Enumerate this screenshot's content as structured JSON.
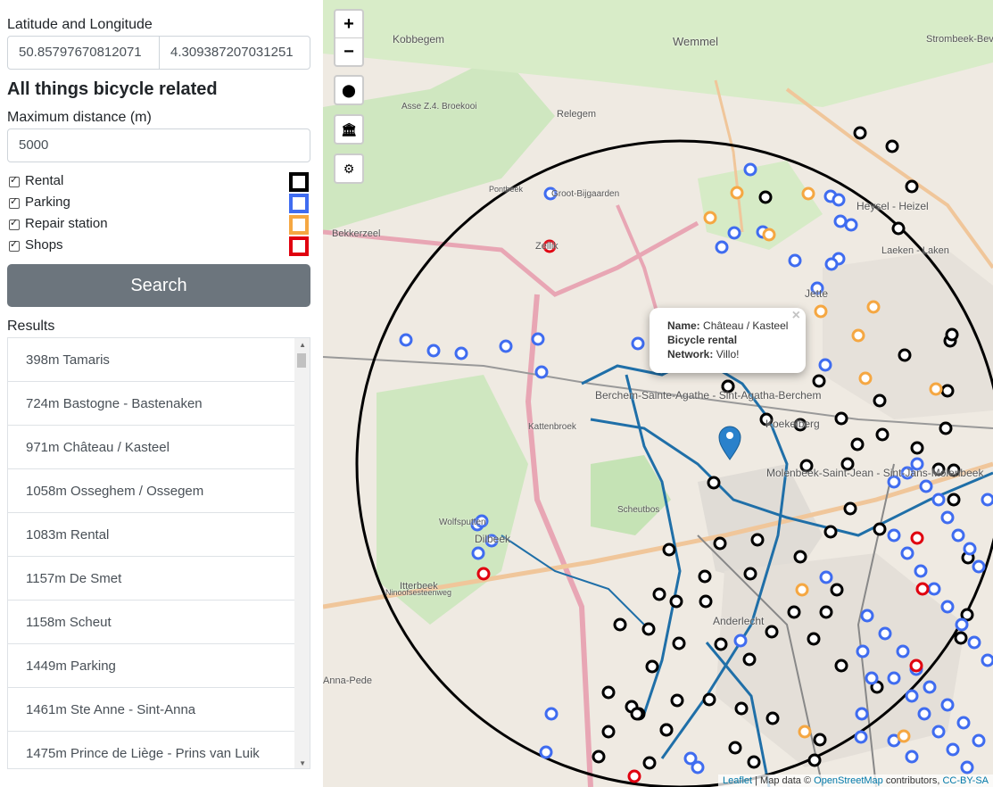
{
  "sidebar": {
    "latlng_label": "Latitude and Longitude",
    "lat": "50.85797670812071",
    "lng": "4.309387207031251",
    "heading": "All things bicycle related",
    "distance_label": "Maximum distance (m)",
    "distance": "5000",
    "categories": [
      {
        "label": "Rental",
        "color": "#000000",
        "checked": true
      },
      {
        "label": "Parking",
        "color": "#3f6cf0",
        "checked": true
      },
      {
        "label": "Repair station",
        "color": "#f5a742",
        "checked": true
      },
      {
        "label": "Shops",
        "color": "#e0000f",
        "checked": true
      }
    ],
    "search_label": "Search",
    "results_label": "Results",
    "results": [
      "398m Tamaris",
      "724m Bastogne - Bastenaken",
      "971m Château / Kasteel",
      "1058m Osseghem / Ossegem",
      "1083m Rental",
      "1157m De Smet",
      "1158m Scheut",
      "1449m Parking",
      "1461m Ste Anne - Sint-Anna",
      "1475m Prince de Liège - Prins van Luik"
    ]
  },
  "map": {
    "zoom_in": "+",
    "zoom_out": "−",
    "popup": {
      "name_key": "Name:",
      "name_val": "Château / Kasteel",
      "type": "Bicycle rental",
      "network_key": "Network:",
      "network_val": "Villo!",
      "close": "×"
    },
    "attribution": {
      "leaflet": "Leaflet",
      "sep": " | Map data © ",
      "osm": "OpenStreetMap",
      "contrib": " contributors, ",
      "license": "CC-BY-SA"
    },
    "places": [
      "Kobbegem",
      "Wemmel",
      "Strombeek-Bever",
      "Relegem",
      "Asse Z.4. Broekooi",
      "Heysel - Heizel",
      "Laeken - Laken",
      "Bekkerzeel",
      "Zellik",
      "Groot-Bijgaarden",
      "Jette",
      "Berchem-Sainte-Agathe - Sint-Agatha-Berchem",
      "Koekelberg",
      "Molenbeek-Saint-Jean - Sint-Jans-Molenbeek",
      "Dilbeek",
      "Anderlecht",
      "Itterbeek",
      "Anna-Pede",
      "Wolfsputten",
      "Scheutbos",
      "Kattenbroek",
      "Pontbeek",
      "Ninoofsesteenweg"
    ]
  }
}
